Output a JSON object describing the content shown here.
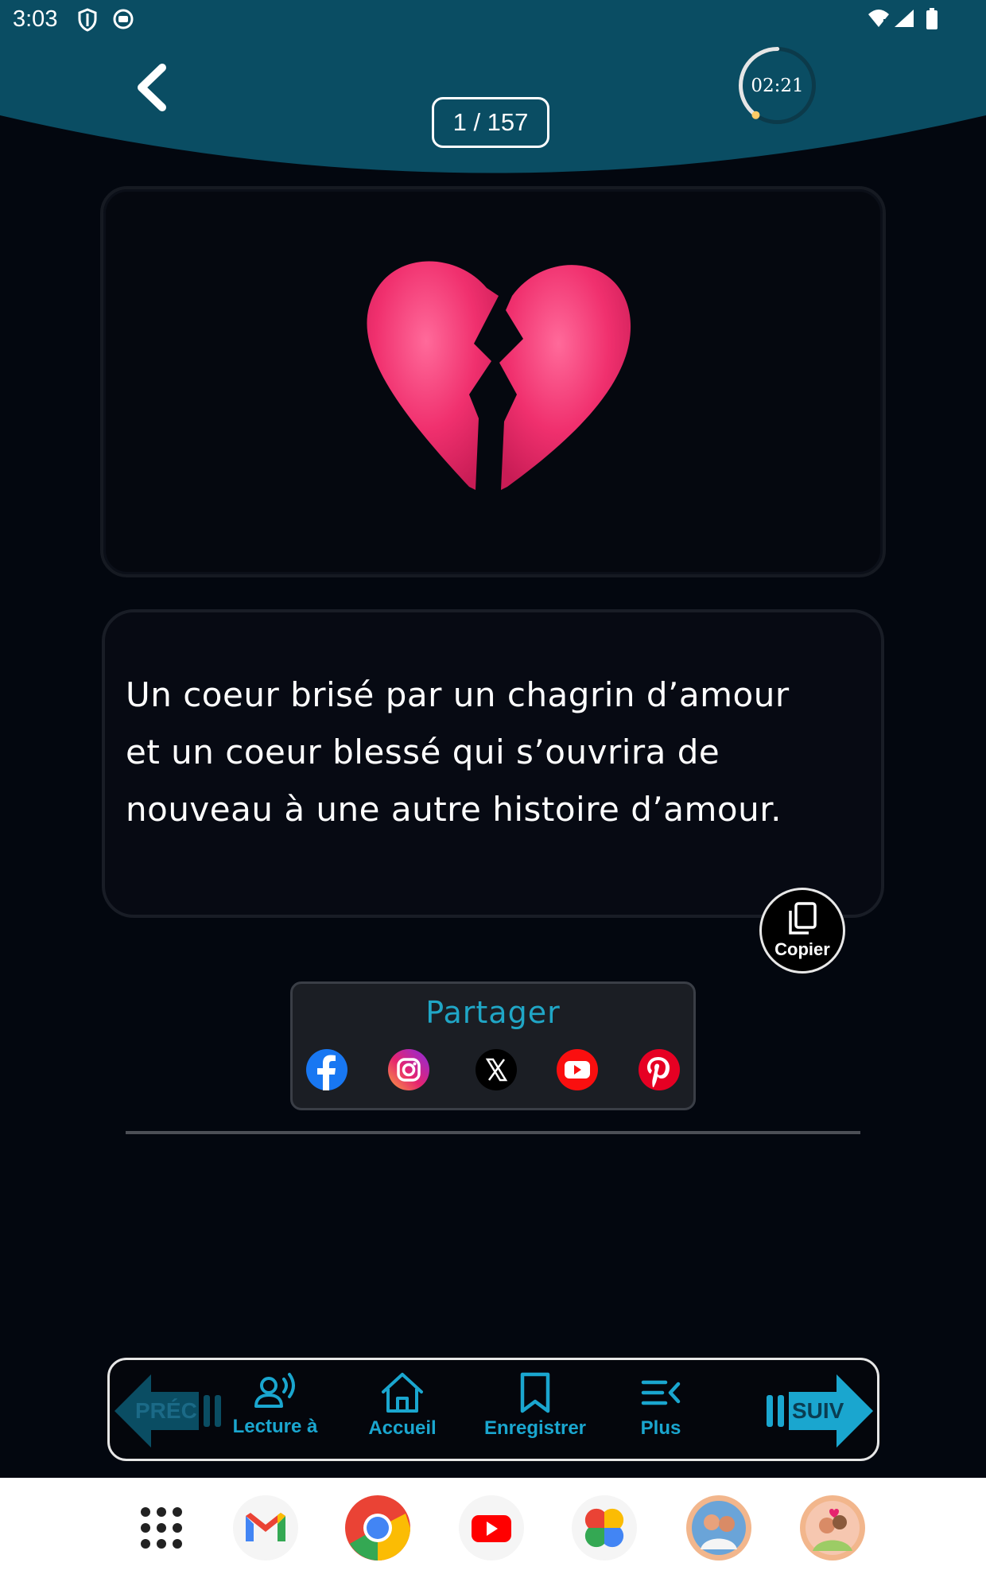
{
  "status_bar": {
    "time": "3:03",
    "left_icons": [
      "shield-icon",
      "notification-app-icon"
    ],
    "right_icons": [
      "wifi-icon",
      "signal-icon",
      "battery-icon"
    ]
  },
  "header": {
    "back_icon": "chevron-left-icon",
    "counter": "1 / 157",
    "timer": "02:21",
    "timer_progress": 0.4,
    "background_color": "#0a4d63"
  },
  "image_card": {
    "image": "broken-heart-emoji",
    "heart_color": "#f0306e"
  },
  "quote": {
    "line1": "Un coeur brisé par un chagrin d’amour",
    "line2": "et un coeur blessé qui s’ouvrira de",
    "line3": "nouveau à une autre histoire d’amour."
  },
  "copy_button": {
    "label": "Copier",
    "icon": "copy-icon"
  },
  "share": {
    "title": "Partager",
    "networks": [
      "facebook",
      "instagram",
      "x",
      "youtube",
      "pinterest"
    ]
  },
  "bottom_nav": {
    "prev_label": "PRÉC",
    "next_label": "SUIV",
    "items": [
      {
        "label": "Lecture à",
        "icon": "voice-icon"
      },
      {
        "label": "Accueil",
        "icon": "home-icon"
      },
      {
        "label": "Enregistrer",
        "icon": "bookmark-icon"
      },
      {
        "label": "Plus",
        "icon": "menu-more-icon"
      }
    ],
    "accent_color": "#1aa6cf"
  },
  "dock": {
    "apps": [
      "app-drawer",
      "gmail",
      "chrome",
      "youtube",
      "photos",
      "couple-app",
      "love-app"
    ]
  }
}
